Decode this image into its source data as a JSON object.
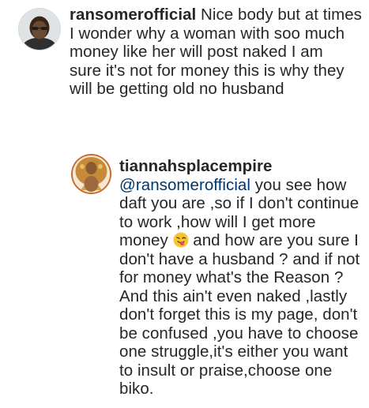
{
  "comments": [
    {
      "username": "ransomerofficial",
      "lines": [
        "Nice body but at times",
        "I wonder why a woman with soo much",
        "money like her will post naked I am",
        "sure it's not for money this is why they",
        "will be getting old no husband"
      ]
    },
    {
      "username": "tiannahsplacempire",
      "mention": "@ransomerofficial",
      "lines": [
        " you see how",
        "daft you are ,so if I don't continue",
        "to work ,how will I get more",
        "money",
        " and how are you sure I",
        "don't have a husband ? and if not",
        "for money what's the Reason ?",
        "And this ain't even naked ,lastly",
        "don't forget this is my page, don't",
        "be confused ,you have to choose",
        "one struggle,it's either you want",
        "to insult or praise,choose one",
        "biko."
      ],
      "emoji": "face-with-tongue-emoji"
    }
  ],
  "colors": {
    "text": "#262626",
    "mention": "#00376b",
    "avatar_ring": "#c76b2a"
  }
}
